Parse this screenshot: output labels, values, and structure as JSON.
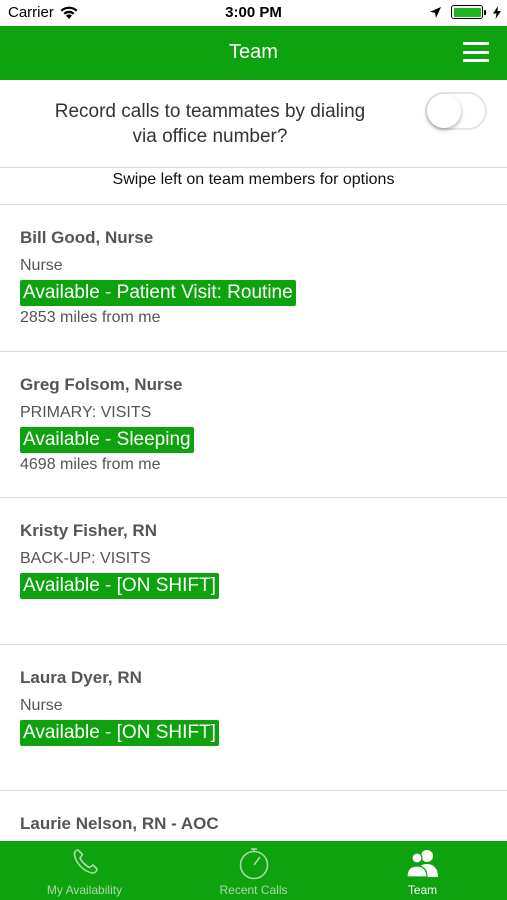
{
  "status_bar": {
    "carrier": "Carrier",
    "time": "3:00 PM"
  },
  "nav": {
    "title": "Team"
  },
  "record_calls": {
    "text": "Record calls to teammates by dialing via office number?",
    "enabled": false
  },
  "hint": "Swipe left on team members for options",
  "members": [
    {
      "name": "Bill Good, Nurse",
      "role": "Nurse",
      "status": "Available - Patient Visit: Routine",
      "distance": "2853 miles from me"
    },
    {
      "name": "Greg Folsom, Nurse",
      "role": "PRIMARY: VISITS",
      "status": "Available - Sleeping",
      "distance": "4698 miles from me"
    },
    {
      "name": "Kristy Fisher, RN",
      "role": "BACK-UP: VISITS",
      "status": "Available - [ON SHIFT]",
      "distance": ""
    },
    {
      "name": "Laura Dyer, RN",
      "role": "Nurse",
      "status": "Available - [ON SHIFT]",
      "distance": ""
    },
    {
      "name": "Laurie Nelson, RN - AOC",
      "role": "",
      "status": "",
      "distance": ""
    }
  ],
  "tabs": [
    {
      "label": "My Availability",
      "icon": "phone-icon",
      "active": false
    },
    {
      "label": "Recent Calls",
      "icon": "stopwatch-icon",
      "active": false
    },
    {
      "label": "Team",
      "icon": "team-icon",
      "active": true
    }
  ],
  "colors": {
    "brand_green": "#0ea20e",
    "inactive_tab": "#a9d9a9"
  }
}
